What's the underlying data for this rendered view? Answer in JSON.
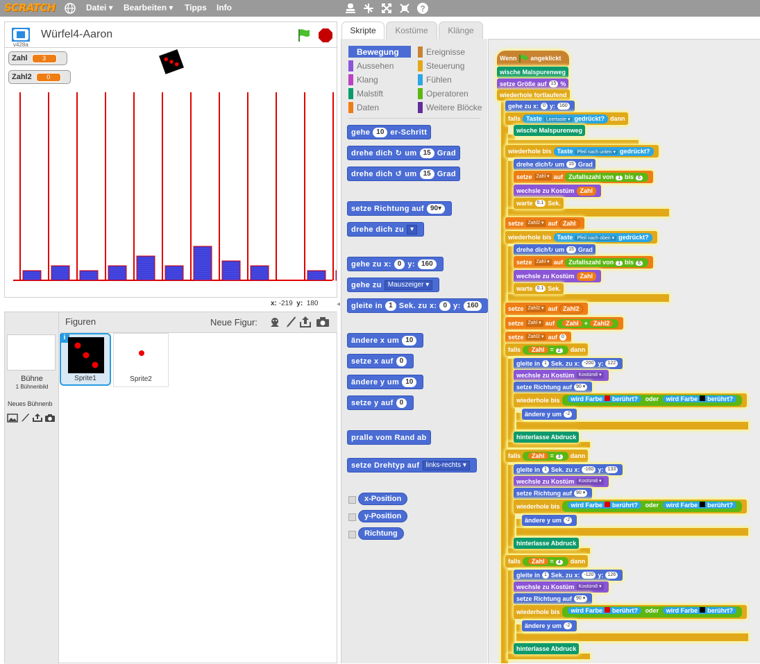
{
  "menu": {
    "logo": "SCRATCH",
    "items": [
      "Datei ▾",
      "Bearbeiten ▾",
      "Tipps",
      "Info"
    ]
  },
  "stage": {
    "project_title": "Würfel4-Aaron",
    "version": "v428a",
    "monitors": [
      {
        "label": "Zahl",
        "value": "3"
      },
      {
        "label": "Zahl2",
        "value": "0"
      }
    ],
    "bars": [
      1,
      2,
      1,
      2,
      4,
      2,
      6,
      3,
      2,
      0,
      1,
      1
    ],
    "coords": {
      "x_label": "x:",
      "x": "-219",
      "y_label": "y:",
      "y": "180"
    },
    "colors": {
      "bar": "#3b3bd6",
      "line": "#e00000"
    }
  },
  "sprites": {
    "header": "Figuren",
    "new_sprite_label": "Neue Figur:",
    "stage_label": "Bühne",
    "stage_count": "1 Bühnenbild",
    "new_backdrop_label": "Neues Bühnenb",
    "items": [
      {
        "name": "Sprite1"
      },
      {
        "name": "Sprite2"
      }
    ]
  },
  "tabs": [
    "Skripte",
    "Kostüme",
    "Klänge"
  ],
  "categories": {
    "left": [
      {
        "label": "Bewegung",
        "color": "#4a6cd4"
      },
      {
        "label": "Aussehen",
        "color": "#8a55d7"
      },
      {
        "label": "Klang",
        "color": "#bb42c3"
      },
      {
        "label": "Malstift",
        "color": "#0e9a6c"
      },
      {
        "label": "Daten",
        "color": "#ee7d16"
      }
    ],
    "right": [
      {
        "label": "Ereignisse",
        "color": "#c88330"
      },
      {
        "label": "Steuerung",
        "color": "#e1a91a"
      },
      {
        "label": "Fühlen",
        "color": "#2ca5e2"
      },
      {
        "label": "Operatoren",
        "color": "#5cb712"
      },
      {
        "label": "Weitere Blöcke",
        "color": "#632d99"
      }
    ]
  },
  "palette": {
    "move": {
      "pre": "gehe",
      "val": "10",
      "post": "er-Schritt"
    },
    "turn_r": {
      "pre": "drehe dich",
      "icon": "↻",
      "mid": "um",
      "val": "15",
      "post": "Grad"
    },
    "turn_l": {
      "pre": "drehe dich",
      "icon": "↺",
      "mid": "um",
      "val": "15",
      "post": "Grad"
    },
    "point_dir": {
      "pre": "setze Richtung auf",
      "val": "90▾"
    },
    "point_to": {
      "pre": "drehe dich zu",
      "val": "▾"
    },
    "goto_xy": {
      "pre": "gehe zu x:",
      "x": "0",
      "ymid": "y:",
      "y": "160"
    },
    "goto": {
      "pre": "gehe zu",
      "val": "Mauszeiger ▾"
    },
    "glide": {
      "pre": "gleite in",
      "t": "1",
      "mid": "Sek. zu x:",
      "x": "0",
      "ymid": "y:",
      "y": "160"
    },
    "change_x": {
      "pre": "ändere x um",
      "val": "10"
    },
    "set_x": {
      "pre": "setze x auf",
      "val": "0"
    },
    "change_y": {
      "pre": "ändere y um",
      "val": "10"
    },
    "set_y": {
      "pre": "setze y auf",
      "val": "0"
    },
    "bounce": {
      "pre": "pralle vom Rand ab"
    },
    "rotation": {
      "pre": "setze Drehtyp auf",
      "val": "links-rechts ▾"
    },
    "reporters": [
      "x-Position",
      "y-Position",
      "Richtung"
    ]
  },
  "script": {
    "hat": {
      "pre": "Wenn",
      "post": "angeklickt"
    },
    "clear": "wische Malspurenweg",
    "size": {
      "pre": "setze Größe auf",
      "val": "15",
      "post": "%"
    },
    "forever": "wiederhole fortlaufend",
    "goto": {
      "pre": "gehe zu x:",
      "x": "0",
      "ymid": "y:",
      "y": "160"
    },
    "if_key": {
      "pre": "falls",
      "sens": "Taste",
      "key": "Leertaste ▾",
      "post": "gedrückt?",
      "then": "dann"
    },
    "clear2": "wische Malspurenweg",
    "until_down": {
      "pre": "wiederhole bis",
      "sens": "Taste",
      "key": "Pfeil nach unten ▾",
      "post": "gedrückt?"
    },
    "turn1": {
      "pre": "drehe dich",
      "mid": "um",
      "val": "15",
      "post": "Grad"
    },
    "set_rand1": {
      "pre": "setze",
      "var": "Zahl ▾",
      "mid": "auf",
      "op": "Zufallszahl von",
      "a": "1",
      "b_mid": "bis",
      "b": "6"
    },
    "costume1": {
      "pre": "wechsle zu Kostüm",
      "var": "Zahl"
    },
    "wait1": {
      "pre": "warte",
      "val": "0.1",
      "post": "Sek."
    },
    "set_z2_a": {
      "pre": "setze",
      "var": "Zahl2 ▾",
      "mid": "auf",
      "val": "Zahl"
    },
    "until_up": {
      "pre": "wiederhole bis",
      "sens": "Taste",
      "key": "Pfeil nach oben ▾",
      "post": "gedrückt?"
    },
    "turn2": {
      "pre": "drehe dich",
      "mid": "um",
      "val": "15",
      "post": "Grad"
    },
    "set_rand2": {
      "pre": "setze",
      "var": "Zahl ▾",
      "mid": "auf",
      "op": "Zufallszahl von",
      "a": "1",
      "b_mid": "bis",
      "b": "6"
    },
    "costume2": {
      "pre": "wechsle zu Kostüm",
      "var": "Zahl"
    },
    "wait2": {
      "pre": "warte",
      "val": "0.1",
      "post": "Sek."
    },
    "set_z2_b": {
      "pre": "setze",
      "var": "Zahl2 ▾",
      "mid": "auf",
      "val": "Zahl2"
    },
    "set_sum": {
      "pre": "setze",
      "var": "Zahl ▾",
      "mid": "auf",
      "a": "Zahl",
      "op": "+",
      "b": "Zahl2"
    },
    "set_z2_0": {
      "pre": "setze",
      "var": "Zahl2 ▾",
      "mid": "auf",
      "val": "0"
    },
    "ifs": [
      {
        "pre": "falls",
        "var": "Zahl",
        "eq": "=",
        "n": "2",
        "then": "dann",
        "glide": {
          "pre": "gleite in",
          "t": "1",
          "mid": "Sek. zu x:",
          "x": "-200",
          "ymid": "y:",
          "y": "122"
        },
        "costume": {
          "pre": "wechsle zu Kostüm",
          "val": "Kostüm8 ▾"
        },
        "dir": {
          "pre": "setze Richtung auf",
          "val": "90 ▾"
        },
        "until": {
          "pre": "wiederhole bis",
          "s1": "wird Farbe",
          "s1b": "berührt?",
          "or": "oder",
          "s2": "wird Farbe",
          "s2b": "berührt?"
        },
        "chy": {
          "pre": "ändere y um",
          "val": "-2"
        },
        "stamp": "hinterlasse Abdruck"
      },
      {
        "pre": "falls",
        "var": "Zahl",
        "eq": "=",
        "n": "3",
        "then": "dann",
        "glide": {
          "pre": "gleite in",
          "t": "1",
          "mid": "Sek. zu x:",
          "x": "-160",
          "ymid": "y:",
          "y": "133"
        },
        "costume": {
          "pre": "wechsle zu Kostüm",
          "val": "Kostüm8 ▾"
        },
        "dir": {
          "pre": "setze Richtung auf",
          "val": "90 ▾"
        },
        "until": {
          "pre": "wiederhole bis",
          "s1": "wird Farbe",
          "s1b": "berührt?",
          "or": "oder",
          "s2": "wird Farbe",
          "s2b": "berührt?"
        },
        "chy": {
          "pre": "ändere y um",
          "val": "-2"
        },
        "stamp": "hinterlasse Abdruck"
      },
      {
        "pre": "falls",
        "var": "Zahl",
        "eq": "=",
        "n": "4",
        "then": "dann",
        "glide": {
          "pre": "gleite in",
          "t": "1",
          "mid": "Sek. zu x:",
          "x": "-120",
          "ymid": "y:",
          "y": "126"
        },
        "costume": {
          "pre": "wechsle zu Kostüm",
          "val": "Kostüm8 ▾"
        },
        "dir": {
          "pre": "setze Richtung auf",
          "val": "90 ▾"
        },
        "until": {
          "pre": "wiederhole bis",
          "s1": "wird Farbe",
          "s1b": "berührt?",
          "or": "oder",
          "s2": "wird Farbe",
          "s2b": "berührt?"
        },
        "chy": {
          "pre": "ändere y um",
          "val": "-2"
        },
        "stamp": "hinterlasse Abdruck"
      }
    ]
  }
}
